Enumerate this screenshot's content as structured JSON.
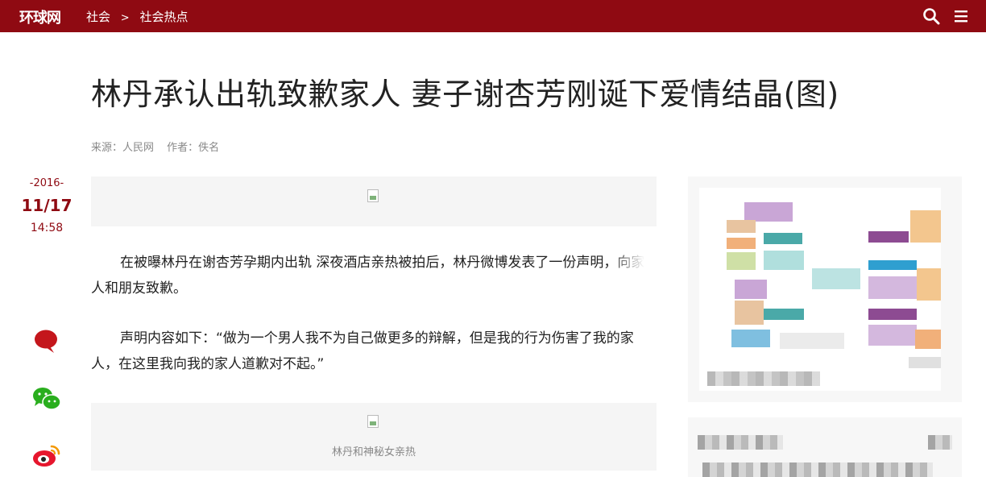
{
  "header": {
    "logo": "环球网",
    "breadcrumb": [
      "社会",
      ">",
      "社会热点"
    ],
    "search_icon": "search-icon",
    "menu_icon": "menu-icon"
  },
  "article": {
    "title": "林丹承认出轨致歉家人 妻子谢杏芳刚诞下爱情结晶(图)",
    "source": "来源：人民网",
    "author": "作者：佚名",
    "date": {
      "year": "-2016-",
      "month_day": "11/17",
      "time": "14:58"
    },
    "paragraphs": [
      "在被曝林丹在谢杏芳孕期内出轨 深夜酒店亲热被拍后，林丹微博发表了一份声明，向家人和朋友致歉。",
      "声明内容如下：“做为一个男人我不为自己做更多的辩解，但是我的行为伤害了我的家人，在这里我向我的家人道歉对不起。”"
    ],
    "image_caption": "林丹和神秘女亲热"
  },
  "share": {
    "icons": [
      "comment-icon",
      "wechat-icon",
      "weibo-icon"
    ],
    "colors": {
      "comment": "#c4161c",
      "wechat": "#2aae1e",
      "weibo": "#e6162d"
    }
  },
  "colors": {
    "brand": "#8f0a12"
  }
}
